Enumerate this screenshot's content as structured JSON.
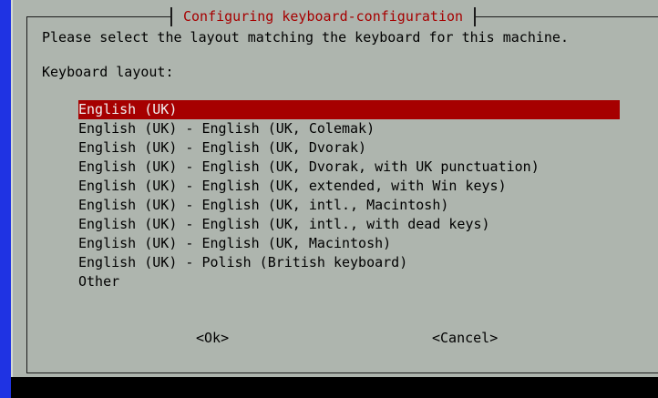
{
  "dialog": {
    "title": "Configuring keyboard-configuration",
    "prompt": "Please select the layout matching the keyboard for this machine.",
    "field_label": "Keyboard layout:",
    "selected_index": 0,
    "options": [
      "English (UK)",
      "English (UK) - English (UK, Colemak)",
      "English (UK) - English (UK, Dvorak)",
      "English (UK) - English (UK, Dvorak, with UK punctuation)",
      "English (UK) - English (UK, extended, with Win keys)",
      "English (UK) - English (UK, intl., Macintosh)",
      "English (UK) - English (UK, intl., with dead keys)",
      "English (UK) - English (UK, Macintosh)",
      "English (UK) - Polish (British keyboard)",
      "Other"
    ],
    "ok_label": "<Ok>",
    "cancel_label": "<Cancel>"
  },
  "colors": {
    "screen_background": "#1f33e3",
    "dialog_background": "#aeb5ae",
    "title_text": "#a60000",
    "selection_background": "#a60000",
    "selection_text": "#f0f0f0"
  }
}
